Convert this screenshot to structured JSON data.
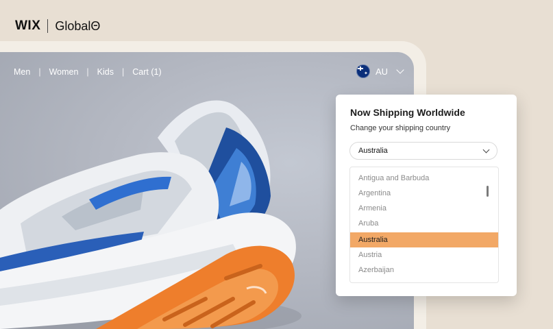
{
  "brand": {
    "wix": "WIX",
    "partner": "GlobalΘ"
  },
  "nav": {
    "items": [
      "Men",
      "Women",
      "Kids",
      "Cart (1)"
    ]
  },
  "country_selector": {
    "code": "AU",
    "flag_icon": "australia-flag-icon"
  },
  "shipping_panel": {
    "title": "Now Shipping Worldwide",
    "subtitle": "Change your shipping country",
    "selected": "Australia",
    "options": [
      "Antigua and Barbuda",
      "Argentina",
      "Armenia",
      "Aruba",
      "Australia",
      "Austria",
      "Azerbaijan"
    ],
    "highlight_color": "#f2a866"
  },
  "colors": {
    "background": "#e8dfd3",
    "sole_orange": "#ee7e2c",
    "accent_blue": "#2f6fd0"
  }
}
